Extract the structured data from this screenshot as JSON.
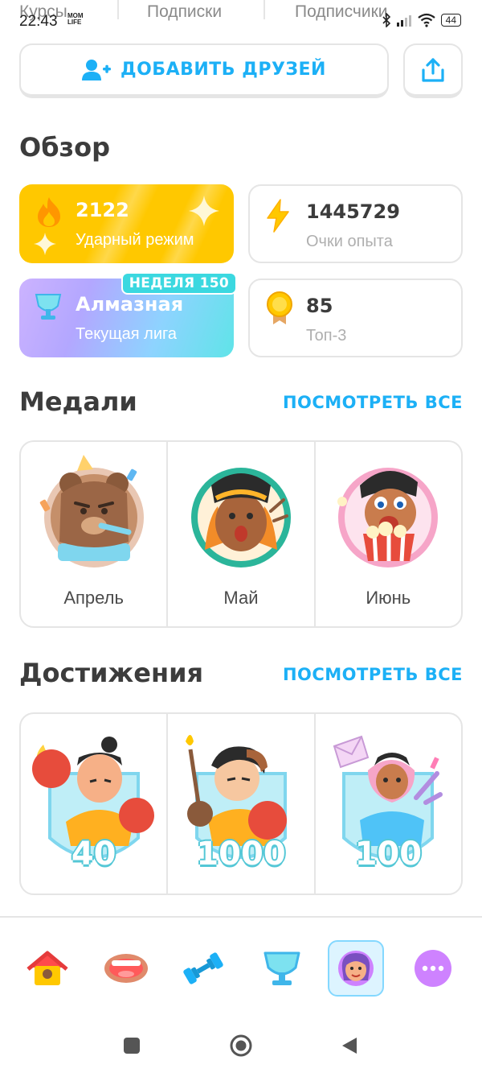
{
  "top_tabs": [
    "Курсы",
    "Подписки",
    "Подписчики"
  ],
  "status_bar": {
    "time": "22:43",
    "app_badge": "MOM LIFE",
    "battery": "44"
  },
  "add_friends": {
    "label": "ДОБАВИТЬ ДРУЗЕЙ"
  },
  "overview": {
    "title": "Обзор",
    "streak": {
      "value": "2122",
      "label": "Ударный режим"
    },
    "xp": {
      "value": "1445729",
      "label": "Очки опыта"
    },
    "league": {
      "value": "Алмазная",
      "label": "Текущая лига",
      "badge": "НЕДЕЛЯ 150"
    },
    "top3": {
      "value": "85",
      "label": "Топ-3"
    }
  },
  "medals": {
    "title": "Медали",
    "view_all": "ПОСМОТРЕТЬ ВСЕ",
    "items": [
      {
        "name": "Апрель"
      },
      {
        "name": "Май"
      },
      {
        "name": "Июнь"
      }
    ]
  },
  "achievements": {
    "title": "Достижения",
    "view_all": "ПОСМОТРЕТЬ ВСЕ",
    "items": [
      {
        "value": "40"
      },
      {
        "value": "1000"
      },
      {
        "value": "100"
      }
    ]
  },
  "bottom_nav": [
    "home-icon",
    "speaking-icon",
    "practice-icon",
    "leagues-icon",
    "profile-icon",
    "more-icon"
  ],
  "colors": {
    "accent": "#1cb0f6",
    "streak": "#ffc800",
    "border": "#e5e5e5",
    "profile_active": "#ddf4ff"
  }
}
